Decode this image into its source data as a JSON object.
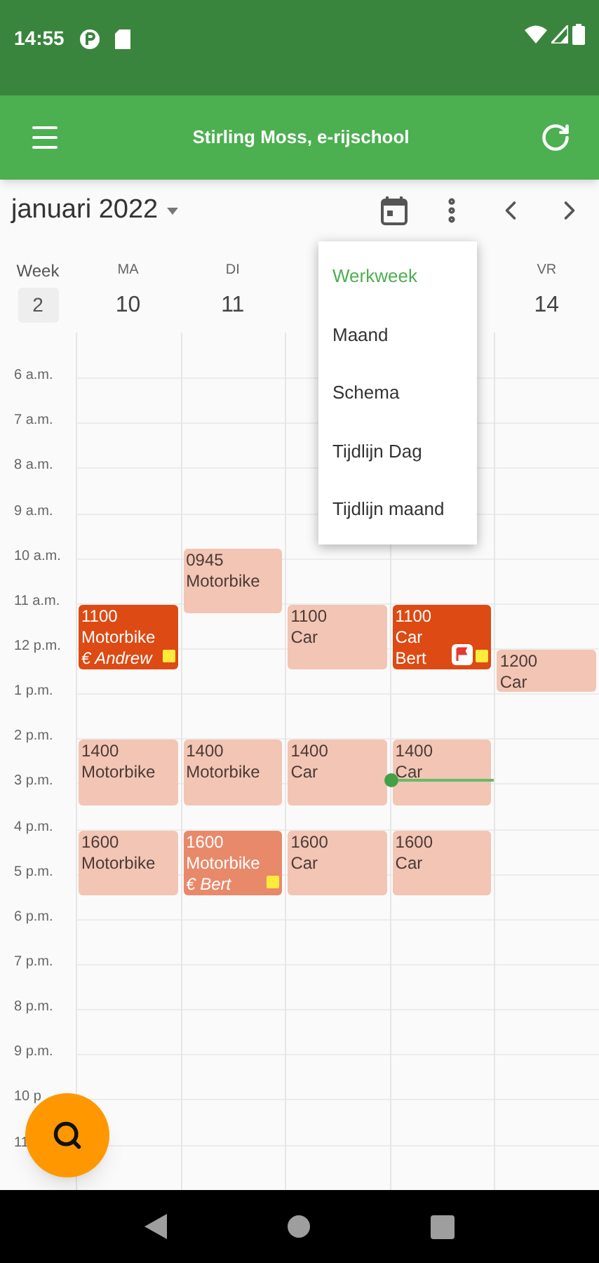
{
  "status_bar": {
    "time": "14:55"
  },
  "app_bar": {
    "title": "Stirling Moss, e-rijschool"
  },
  "toolbar": {
    "month": "januari 2022"
  },
  "week": {
    "label": "Week",
    "number": "2"
  },
  "hours": [
    "6 a.m.",
    "7 a.m.",
    "8 a.m.",
    "9 a.m.",
    "10 a.m.",
    "11 a.m.",
    "12 p.m.",
    "1 p.m.",
    "2 p.m.",
    "3 p.m.",
    "4 p.m.",
    "5 p.m.",
    "6 p.m.",
    "7 p.m.",
    "8 p.m.",
    "9 p.m.",
    "10 p",
    "11"
  ],
  "days": [
    {
      "label": "MA",
      "date": "10",
      "today": false,
      "events": [
        {
          "start": "1100",
          "lines": [
            {
              "text": "Motorbike",
              "italic": false
            },
            {
              "text": "€ Andrew",
              "italic": true
            }
          ],
          "kind": "lesson",
          "color": "#dd4a14",
          "note": true,
          "flagged": false
        },
        {
          "start": "1400",
          "lines": [
            {
              "text": "Motorbike",
              "italic": false
            }
          ],
          "kind": "lesson",
          "color": "#f3c5b5",
          "note": false,
          "flagged": false
        },
        {
          "start": "1600",
          "lines": [
            {
              "text": "Motorbike",
              "italic": false
            }
          ],
          "kind": "lesson",
          "color": "#f3c5b5",
          "note": false,
          "flagged": false
        }
      ]
    },
    {
      "label": "DI",
      "date": "11",
      "today": false,
      "events": [
        {
          "start": "0945",
          "lines": [
            {
              "text": "Motorbike",
              "italic": false
            }
          ],
          "kind": "lesson",
          "color": "#f3c5b5",
          "note": false,
          "flagged": false
        },
        {
          "start": "1400",
          "lines": [
            {
              "text": "Motorbike",
              "italic": false
            }
          ],
          "kind": "lesson",
          "color": "#f3c5b5",
          "note": false,
          "flagged": false
        },
        {
          "start": "1600",
          "lines": [
            {
              "text": "Motorbike",
              "italic": false
            },
            {
              "text": "€ Bert",
              "italic": true
            }
          ],
          "kind": "lesson",
          "color": "#e8896a",
          "note": true,
          "flagged": false
        }
      ]
    },
    {
      "today": false,
      "events": [
        {
          "start": "1100",
          "lines": [
            {
              "text": "Car",
              "italic": false
            }
          ],
          "kind": "lesson",
          "color": "#f3c5b5",
          "note": false,
          "flagged": false
        },
        {
          "start": "1400",
          "lines": [
            {
              "text": "Car",
              "italic": false
            }
          ],
          "kind": "lesson",
          "color": "#f3c5b5",
          "note": false,
          "flagged": false
        },
        {
          "start": "1600",
          "lines": [
            {
              "text": "Car",
              "italic": false
            }
          ],
          "kind": "lesson",
          "color": "#f3c5b5",
          "note": false,
          "flagged": false
        }
      ]
    },
    {
      "today": true,
      "events": [
        {
          "start": "1100",
          "lines": [
            {
              "text": "Car",
              "italic": false
            },
            {
              "text": "Bert",
              "italic": false
            }
          ],
          "kind": "lesson",
          "color": "#dd4a14",
          "note": true,
          "flagged": true
        },
        {
          "start": "1400",
          "lines": [
            {
              "text": "Car",
              "italic": false
            }
          ],
          "kind": "lesson",
          "color": "#f3c5b5",
          "note": false,
          "flagged": false
        },
        {
          "start": "1600",
          "lines": [
            {
              "text": "Car",
              "italic": false
            }
          ],
          "kind": "lesson",
          "color": "#f3c5b5",
          "note": false,
          "flagged": false
        }
      ]
    },
    {
      "label": "VR",
      "date": "14",
      "today": false,
      "events": [
        {
          "start": "1200",
          "lines": [
            {
              "text": "Car",
              "italic": false
            }
          ],
          "kind": "short",
          "color": "#f3c5b5",
          "note": false,
          "flagged": false
        }
      ]
    }
  ],
  "view_menu": [
    {
      "label": "Werkweek",
      "selected": true
    },
    {
      "label": "Maand",
      "selected": false
    },
    {
      "label": "Schema",
      "selected": false
    },
    {
      "label": "Tijdlijn Dag",
      "selected": false
    },
    {
      "label": "Tijdlijn maand",
      "selected": false
    }
  ]
}
